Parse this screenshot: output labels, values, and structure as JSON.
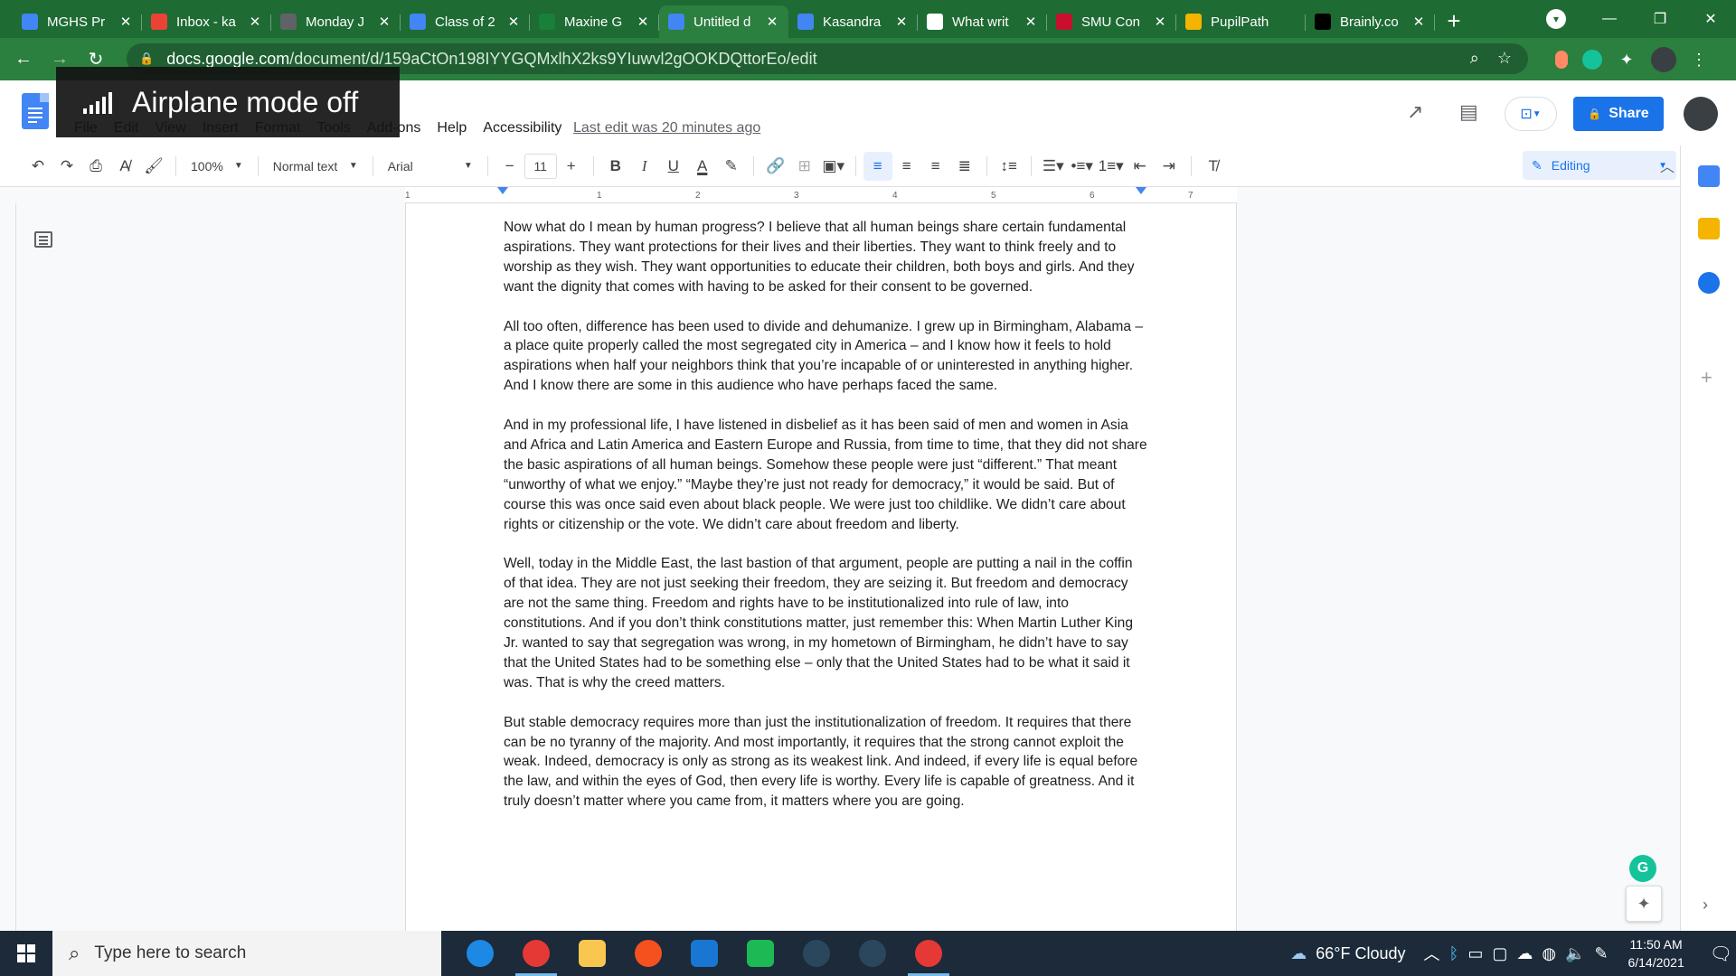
{
  "browser": {
    "tabs": [
      {
        "title": "MGHS Pr",
        "favicon_color": "#4285f4",
        "favicon": "docs-icon",
        "active": false
      },
      {
        "title": "Inbox - ka",
        "favicon_color": "#ea4335",
        "favicon": "gmail-icon",
        "active": false
      },
      {
        "title": "Monday J",
        "favicon_color": "#5f6368",
        "favicon": "classroom-icon",
        "active": false
      },
      {
        "title": "Class of 2",
        "favicon_color": "#4285f4",
        "favicon": "slides-icon",
        "active": false
      },
      {
        "title": "Maxine G",
        "favicon_color": "#188038",
        "favicon": "classroom-icon",
        "active": false
      },
      {
        "title": "Untitled d",
        "favicon_color": "#4285f4",
        "favicon": "docs-icon",
        "active": true
      },
      {
        "title": "Kasandra",
        "favicon_color": "#4285f4",
        "favicon": "docs-icon",
        "active": false
      },
      {
        "title": "What writ",
        "favicon_color": "#ffffff",
        "favicon": "google-icon",
        "active": false
      },
      {
        "title": "SMU Con",
        "favicon_color": "#c8102e",
        "favicon": "smu-icon",
        "active": false
      },
      {
        "title": "PupilPath",
        "favicon_color": "#f4b400",
        "favicon": "pupilpath-icon",
        "active": false
      },
      {
        "title": "Brainly.co",
        "favicon_color": "#000000",
        "favicon": "brainly-icon",
        "active": false
      }
    ],
    "url_host": "docs.google.com",
    "url_path": "/document/d/159aCtOn198IYYGQMxlhX2ks9YIuwvl2gOOKDQttorEo/edit"
  },
  "toast": {
    "text": "Airplane mode off"
  },
  "docs": {
    "menu": [
      "File",
      "Edit",
      "View",
      "Insert",
      "Format",
      "Tools",
      "Add-ons",
      "Help",
      "Accessibility"
    ],
    "last_edit": "Last edit was 20 minutes ago",
    "share_label": "Share",
    "toolbar": {
      "zoom": "100%",
      "style": "Normal text",
      "font": "Arial",
      "font_size": "11",
      "mode": "Editing"
    },
    "ruler_ticks": [
      "1",
      "1",
      "2",
      "3",
      "4",
      "5",
      "6",
      "7"
    ],
    "paragraphs": [
      "Now what do I mean by human progress? I believe that all human beings share certain fundamental aspirations. They want protections for their lives and their liberties. They want to think freely and to worship as they wish. They want opportunities to educate their children, both boys and girls. And they want the dignity that comes with having to be asked for their consent to be governed.",
      "All too often, difference has been used to divide and dehumanize. I grew up in Birmingham, Alabama – a place quite properly called the most segregated city in America – and I know how it feels to hold aspirations when half your neighbors think that you’re incapable of or uninterested in anything higher. And I know there are some in this audience who have perhaps faced the same.",
      "And in my professional life, I have listened in disbelief as it has been said of men and women in Asia and Africa and Latin America and Eastern Europe and Russia, from time to time, that they did not share the basic aspirations of all human beings. Somehow these people were just “different.” That meant “unworthy of what we enjoy.” “Maybe they’re just not ready for democracy,” it would be said. But of course this was once said even about black people. We were just too childlike. We didn’t care about rights or citizenship or the vote. We didn’t care about freedom and liberty.",
      "Well, today in the Middle East, the last bastion of that argument, people are putting a nail in the coffin of that idea. They are not just seeking their freedom, they are seizing it. But freedom and democracy are not the same thing. Freedom and rights have to be institutionalized into rule of law, into constitutions. And if you don’t think constitutions matter, just remember this: When Martin Luther King Jr. wanted to say that segregation was wrong, in my hometown of Birmingham, he didn’t have to say that the United States had to be something else – only that the United States had to be what it said it was. That is why the creed matters.",
      "But stable democracy requires more than just the institutionalization of freedom. It requires that there can be no tyranny of the majority. And most importantly, it requires that the strong cannot exploit the weak. Indeed, democracy is only as strong as its weakest link. And indeed, if every life is equal before the law, and within the eyes of God, then every life is worthy. Every life is capable of greatness. And it truly doesn’t matter where you came from, it matters where you are going."
    ]
  },
  "taskbar": {
    "search_placeholder": "Type here to search",
    "weather": "66°F  Cloudy",
    "time": "11:50 AM",
    "date": "6/14/2021"
  }
}
